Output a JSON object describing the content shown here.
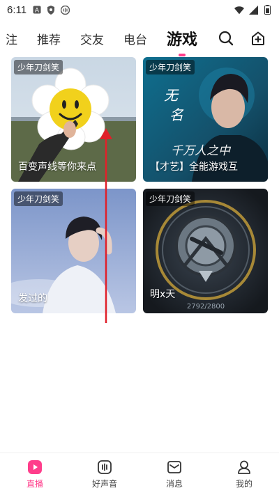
{
  "status_bar": {
    "time": "6:11"
  },
  "top_nav": {
    "tabs": [
      {
        "label": "注",
        "active": false
      },
      {
        "label": "推荐",
        "active": false
      },
      {
        "label": "交友",
        "active": false
      },
      {
        "label": "电台",
        "active": false
      },
      {
        "label": "游戏",
        "active": true
      }
    ]
  },
  "cards": [
    {
      "tag": "少年刀剑笑",
      "title": "百变声线等你来点"
    },
    {
      "tag": "少年刀剑笑",
      "title": "【才艺】全能游戏互",
      "overlay_text_1": "无",
      "overlay_text_2": "名",
      "overlay_text_3": "千万人之中"
    },
    {
      "tag": "少年刀剑笑",
      "title": "发过的"
    },
    {
      "tag": "少年刀剑笑",
      "title": "明x天",
      "score": "2792/2800"
    }
  ],
  "bottom_nav": [
    {
      "label": "直播",
      "icon": "live-icon",
      "active": true
    },
    {
      "label": "好声音",
      "icon": "voice-icon",
      "active": false
    },
    {
      "label": "消息",
      "icon": "message-icon",
      "active": false
    },
    {
      "label": "我的",
      "icon": "profile-icon",
      "active": false
    }
  ],
  "colors": {
    "accent": "#ff3d8b",
    "arrow": "#e0202a"
  }
}
